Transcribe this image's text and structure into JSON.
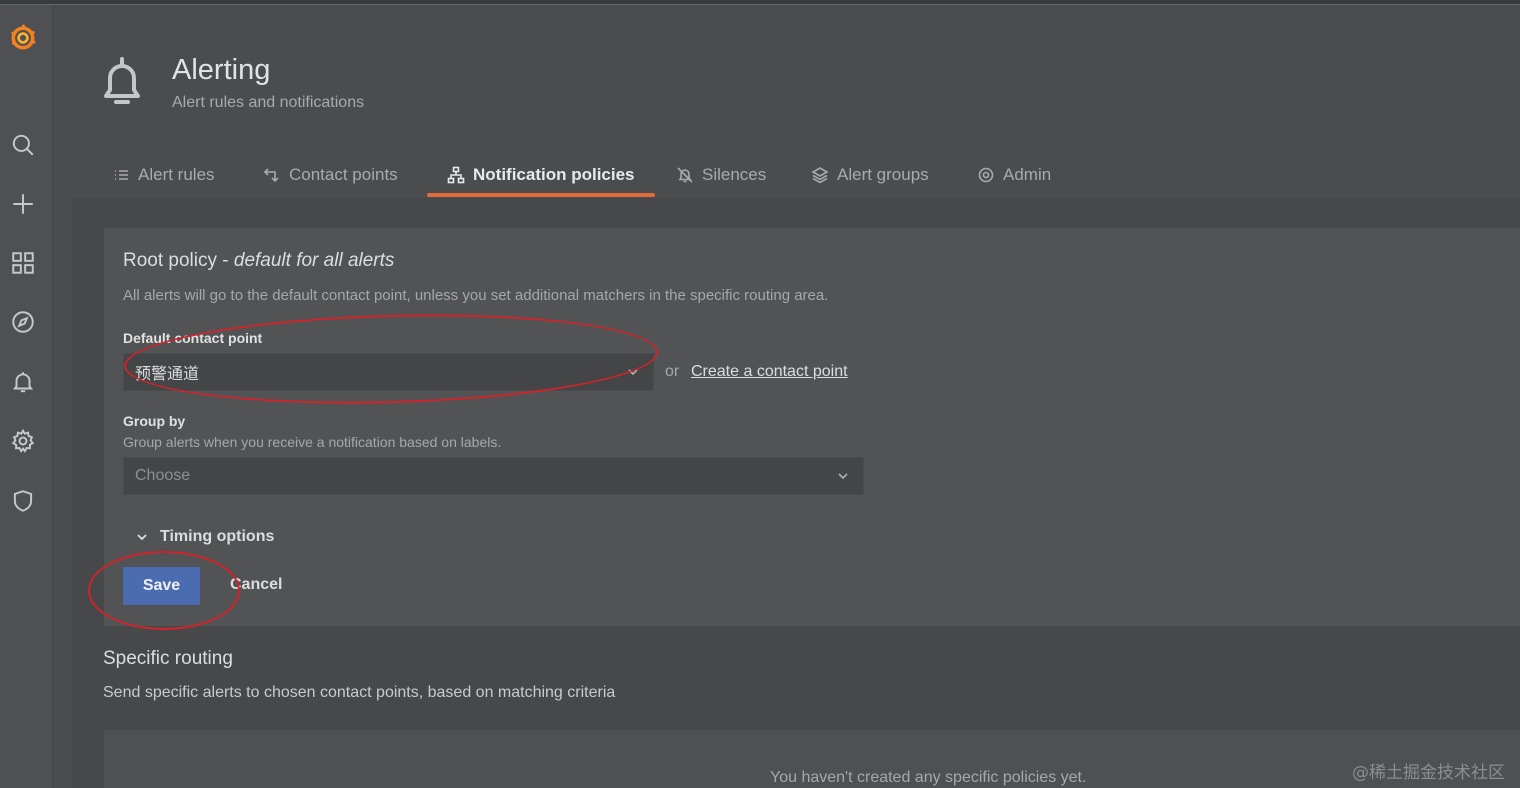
{
  "header": {
    "title": "Alerting",
    "subtitle": "Alert rules and notifications"
  },
  "tabs": [
    {
      "label": "Alert rules",
      "icon": "list-icon"
    },
    {
      "label": "Contact points",
      "icon": "contact-points-icon"
    },
    {
      "label": "Notification policies",
      "icon": "sitemap-icon",
      "active": true
    },
    {
      "label": "Silences",
      "icon": "bell-slash-icon"
    },
    {
      "label": "Alert groups",
      "icon": "layers-icon"
    },
    {
      "label": "Admin",
      "icon": "cog-icon"
    }
  ],
  "root_policy": {
    "title": "Root policy - ",
    "title_em": "default for all alerts",
    "description": "All alerts will go to the default contact point, unless you set additional matchers in the specific routing area.",
    "default_contact_label": "Default contact point",
    "default_contact_value": "预警通道",
    "or_text": "or",
    "create_link": "Create a contact point",
    "group_by_label": "Group by",
    "group_by_hint": "Group alerts when you receive a notification based on labels.",
    "group_by_placeholder": "Choose",
    "timing_label": "Timing options",
    "save_label": "Save",
    "cancel_label": "Cancel"
  },
  "specific_routing": {
    "title": "Specific routing",
    "description": "Send specific alerts to chosen contact points, based on matching criteria",
    "empty_text": "You haven't created any specific policies yet."
  },
  "watermark": "@稀土掘金技术社区",
  "colors": {
    "accent_tab": "#e06c3a",
    "primary_button": "#4b6cb1",
    "annotation": "#d0242a"
  }
}
